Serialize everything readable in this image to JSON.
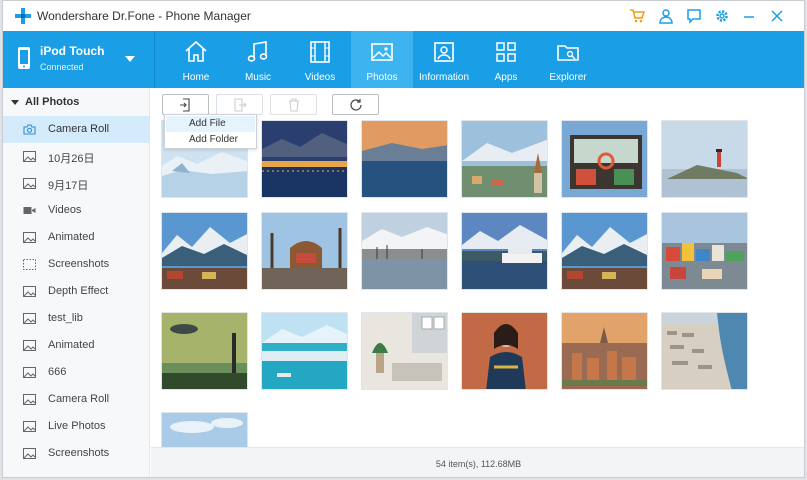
{
  "app": {
    "title": "Wondershare Dr.Fone - Phone Manager"
  },
  "device": {
    "name": "iPod Touch",
    "status": "Connected"
  },
  "tabs": [
    {
      "label": "Home",
      "icon": "home-icon"
    },
    {
      "label": "Music",
      "icon": "music-icon"
    },
    {
      "label": "Videos",
      "icon": "video-icon"
    },
    {
      "label": "Photos",
      "icon": "photo-icon",
      "active": true
    },
    {
      "label": "Information",
      "icon": "contact-card-icon"
    },
    {
      "label": "Apps",
      "icon": "apps-grid-icon"
    },
    {
      "label": "Explorer",
      "icon": "folder-icon"
    }
  ],
  "sidebar": {
    "header": "All Photos",
    "items": [
      {
        "label": "Camera Roll",
        "icon": "camera-icon",
        "active": true
      },
      {
        "label": "10月26日",
        "icon": "image-icon"
      },
      {
        "label": "9月17日",
        "icon": "image-icon"
      },
      {
        "label": "Videos",
        "icon": "video-camera-icon"
      },
      {
        "label": "Animated",
        "icon": "image-icon"
      },
      {
        "label": "Screenshots",
        "icon": "screenshot-icon"
      },
      {
        "label": "Depth Effect",
        "icon": "image-icon"
      },
      {
        "label": "test_lib",
        "icon": "image-icon"
      },
      {
        "label": "Animated",
        "icon": "image-icon"
      },
      {
        "label": "666",
        "icon": "image-icon"
      },
      {
        "label": "Camera Roll",
        "icon": "image-icon"
      },
      {
        "label": "Live Photos",
        "icon": "image-icon"
      },
      {
        "label": "Screenshots",
        "icon": "image-icon"
      }
    ]
  },
  "toolbar": {
    "buttons": [
      {
        "name": "add",
        "icon": "add-icon",
        "enabled": true
      },
      {
        "name": "export",
        "icon": "export-icon",
        "enabled": false
      },
      {
        "name": "delete",
        "icon": "trash-icon",
        "enabled": false
      },
      {
        "name": "refresh",
        "icon": "refresh-icon",
        "enabled": true
      }
    ]
  },
  "add_menu": {
    "items": [
      "Add File",
      "Add Folder"
    ]
  },
  "photos": [
    {
      "scene": "glacier"
    },
    {
      "scene": "harbor-night"
    },
    {
      "scene": "sunset-lake"
    },
    {
      "scene": "church-town"
    },
    {
      "scene": "booth"
    },
    {
      "scene": "lighthouse"
    },
    {
      "scene": "mountains-village"
    },
    {
      "scene": "wooden-sign"
    },
    {
      "scene": "harbor-town"
    },
    {
      "scene": "cruise-ship"
    },
    {
      "scene": "mountains-village"
    },
    {
      "scene": "colorful-town"
    },
    {
      "scene": "ufo"
    },
    {
      "scene": "glacier-lagoon"
    },
    {
      "scene": "interior"
    },
    {
      "scene": "portrait"
    },
    {
      "scene": "old-town"
    },
    {
      "scene": "coastal-city"
    },
    {
      "scene": "sky"
    }
  ],
  "footer": {
    "status": "54 item(s), 112.68MB"
  },
  "colors": {
    "accent": "#1a9ee6",
    "accent_active": "#3db3f0",
    "title_icon": "#f39a1b"
  }
}
